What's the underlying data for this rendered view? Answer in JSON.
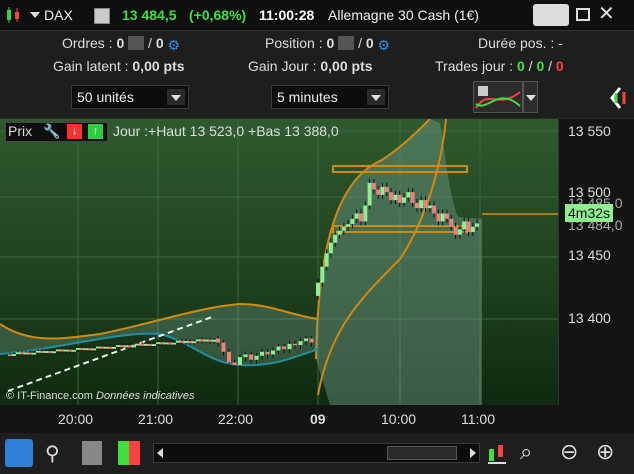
{
  "title": {
    "symbol": "DAX",
    "price": "13 484,5",
    "change": "(+0,68%)",
    "time": "11:00:28",
    "instrument": "Allemagne 30 Cash (1€)"
  },
  "info": {
    "orders_label": "Ordres :",
    "orders_a": "0",
    "orders_sep": "/",
    "orders_b": "0",
    "position_label": "Position :",
    "position_a": "0",
    "position_sep": "/",
    "position_b": "0",
    "duration_label": "Durée pos. :",
    "duration_value": "-",
    "latent_label": "Gain latent :",
    "latent_value": "0,00 pts",
    "day_label": "Gain Jour :",
    "day_value": "0,00 pts",
    "trades_label": "Trades jour :",
    "trades_a": "0",
    "trades_sep1": "/",
    "trades_b": "0",
    "trades_sep2": "/",
    "trades_c": "0"
  },
  "controls": {
    "units": "50 unités",
    "timeframe": "5 minutes"
  },
  "chart": {
    "legend_prefix": "Prix",
    "legend_text": "Jour :+Haut 13 523,0 +Bas 13 388,0",
    "countdown": "4m32s",
    "price_tag_top": "13 485,0",
    "price_tag_bottom": "13 484,0",
    "credit": "© IT-Finance.com",
    "credit_note": "Données indicatives",
    "y_ticks": [
      "13 550",
      "13 500",
      "13 450",
      "13 400"
    ],
    "x_ticks": [
      "20:00",
      "21:00",
      "22:00",
      "09",
      "10:00",
      "11:00"
    ]
  },
  "colors": {
    "up": "#2ecc40",
    "down": "#ff3030",
    "accent_blue": "#2f7fd6",
    "bull_candle": "#90ee90",
    "bear_candle": "#f08080",
    "band": "#d08a10"
  },
  "chart_data": {
    "type": "candlestick",
    "title": "",
    "ylim": [
      13348,
      13563
    ],
    "x_ticks": [
      "20:00",
      "21:00",
      "22:00",
      "09",
      "10:00",
      "11:00"
    ],
    "y_ticks": [
      13550,
      13500,
      13450,
      13400
    ],
    "last_price": 13484.5,
    "day_high": 13523.0,
    "day_low": 13388.0,
    "session1": {
      "close_start": 13386,
      "close_end": 13397,
      "high_end": 13401
    },
    "session2": {
      "open": 13450,
      "peak": 13518,
      "last": 13484.5
    }
  }
}
